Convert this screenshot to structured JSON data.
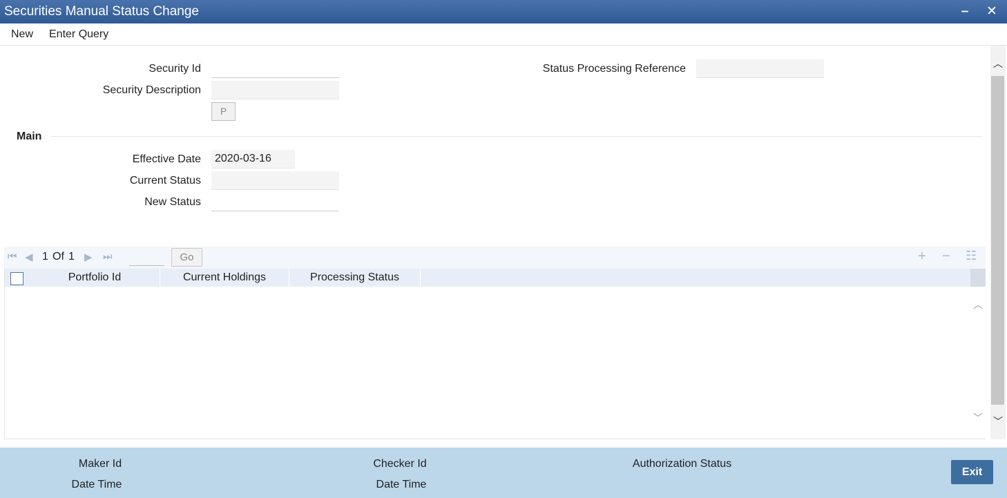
{
  "window": {
    "title": "Securities Manual Status Change",
    "minimize_glyph": "–",
    "close_glyph": "✕"
  },
  "menu": {
    "new_label": "New",
    "enter_query_label": "Enter Query"
  },
  "form": {
    "security_id_label": "Security Id",
    "security_id_value": "",
    "security_description_label": "Security Description",
    "security_description_value": "",
    "p_button_label": "P",
    "status_processing_reference_label": "Status Processing Reference",
    "status_processing_reference_value": ""
  },
  "main": {
    "section_title": "Main",
    "effective_date_label": "Effective Date",
    "effective_date_value": "2020-03-16",
    "current_status_label": "Current Status",
    "current_status_value": "",
    "new_status_label": "New Status",
    "new_status_value": ""
  },
  "pager": {
    "current_page": "1",
    "of_label": "Of",
    "total_pages": "1",
    "go_label": "Go",
    "add_glyph": "+",
    "remove_glyph": "−",
    "list_glyph": "☷"
  },
  "grid": {
    "columns": [
      "Portfolio Id",
      "Current Holdings",
      "Processing Status"
    ],
    "rows": []
  },
  "footer": {
    "maker_id_label": "Maker Id",
    "maker_datetime_label": "Date Time",
    "checker_id_label": "Checker Id",
    "checker_datetime_label": "Date Time",
    "authorization_status_label": "Authorization Status",
    "exit_label": "Exit"
  },
  "colors": {
    "titlebar": "#2f5a96",
    "footer": "#bcd7ea",
    "exit_button": "#3d6e9f",
    "grid_header": "#e8eef7"
  }
}
